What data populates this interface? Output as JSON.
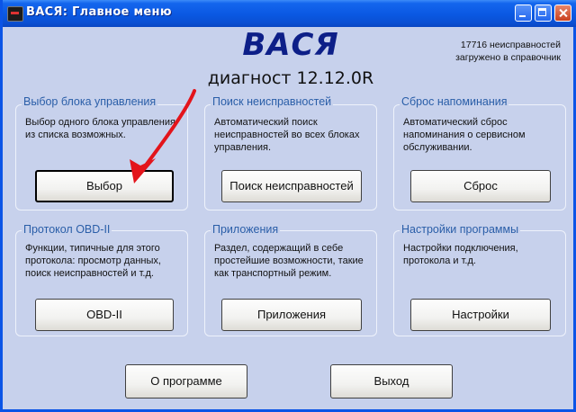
{
  "window": {
    "title": "ВАСЯ:  Главное меню",
    "title_color": "#0b54e6",
    "background": "#c7d1ec"
  },
  "header": {
    "app_name": "ВАСЯ",
    "subtitle": "диагност 12.12.0R",
    "faults_line1": "17716 неисправностей",
    "faults_line2": "загружено в справочник"
  },
  "groups": {
    "select_unit": {
      "title": "Выбор блока управления",
      "desc": "Выбор одного блока управления\nиз списка возможных.",
      "button": "Выбор"
    },
    "fault_search": {
      "title": "Поиск неисправностей",
      "desc": "Автоматический поиск\nнеисправностей во всех блоках\nуправления.",
      "button": "Поиск неисправностей"
    },
    "reset_reminder": {
      "title": "Сброс напоминания",
      "desc": "Автоматический сброс\nнапоминания о сервисном\nобслуживании.",
      "button": "Сброс"
    },
    "obd2": {
      "title": "Протокол OBD-II",
      "desc": "Функции, типичные для этого\nпротокола: просмотр данных,\nпоиск неисправностей и т.д.",
      "button": "OBD-II"
    },
    "apps": {
      "title": "Приложения",
      "desc": "Раздел, содержащий в себе\nпростейшие возможности, такие\nкак транспортный режим.",
      "button": "Приложения"
    },
    "settings": {
      "title": "Настройки программы",
      "desc": "Настройки подключения,\nпротокола и т.д.",
      "button": "Настройки"
    }
  },
  "footer": {
    "about_button": "О программе",
    "exit_button": "Выход"
  },
  "annotation": {
    "arrow_color": "#e3141b"
  }
}
